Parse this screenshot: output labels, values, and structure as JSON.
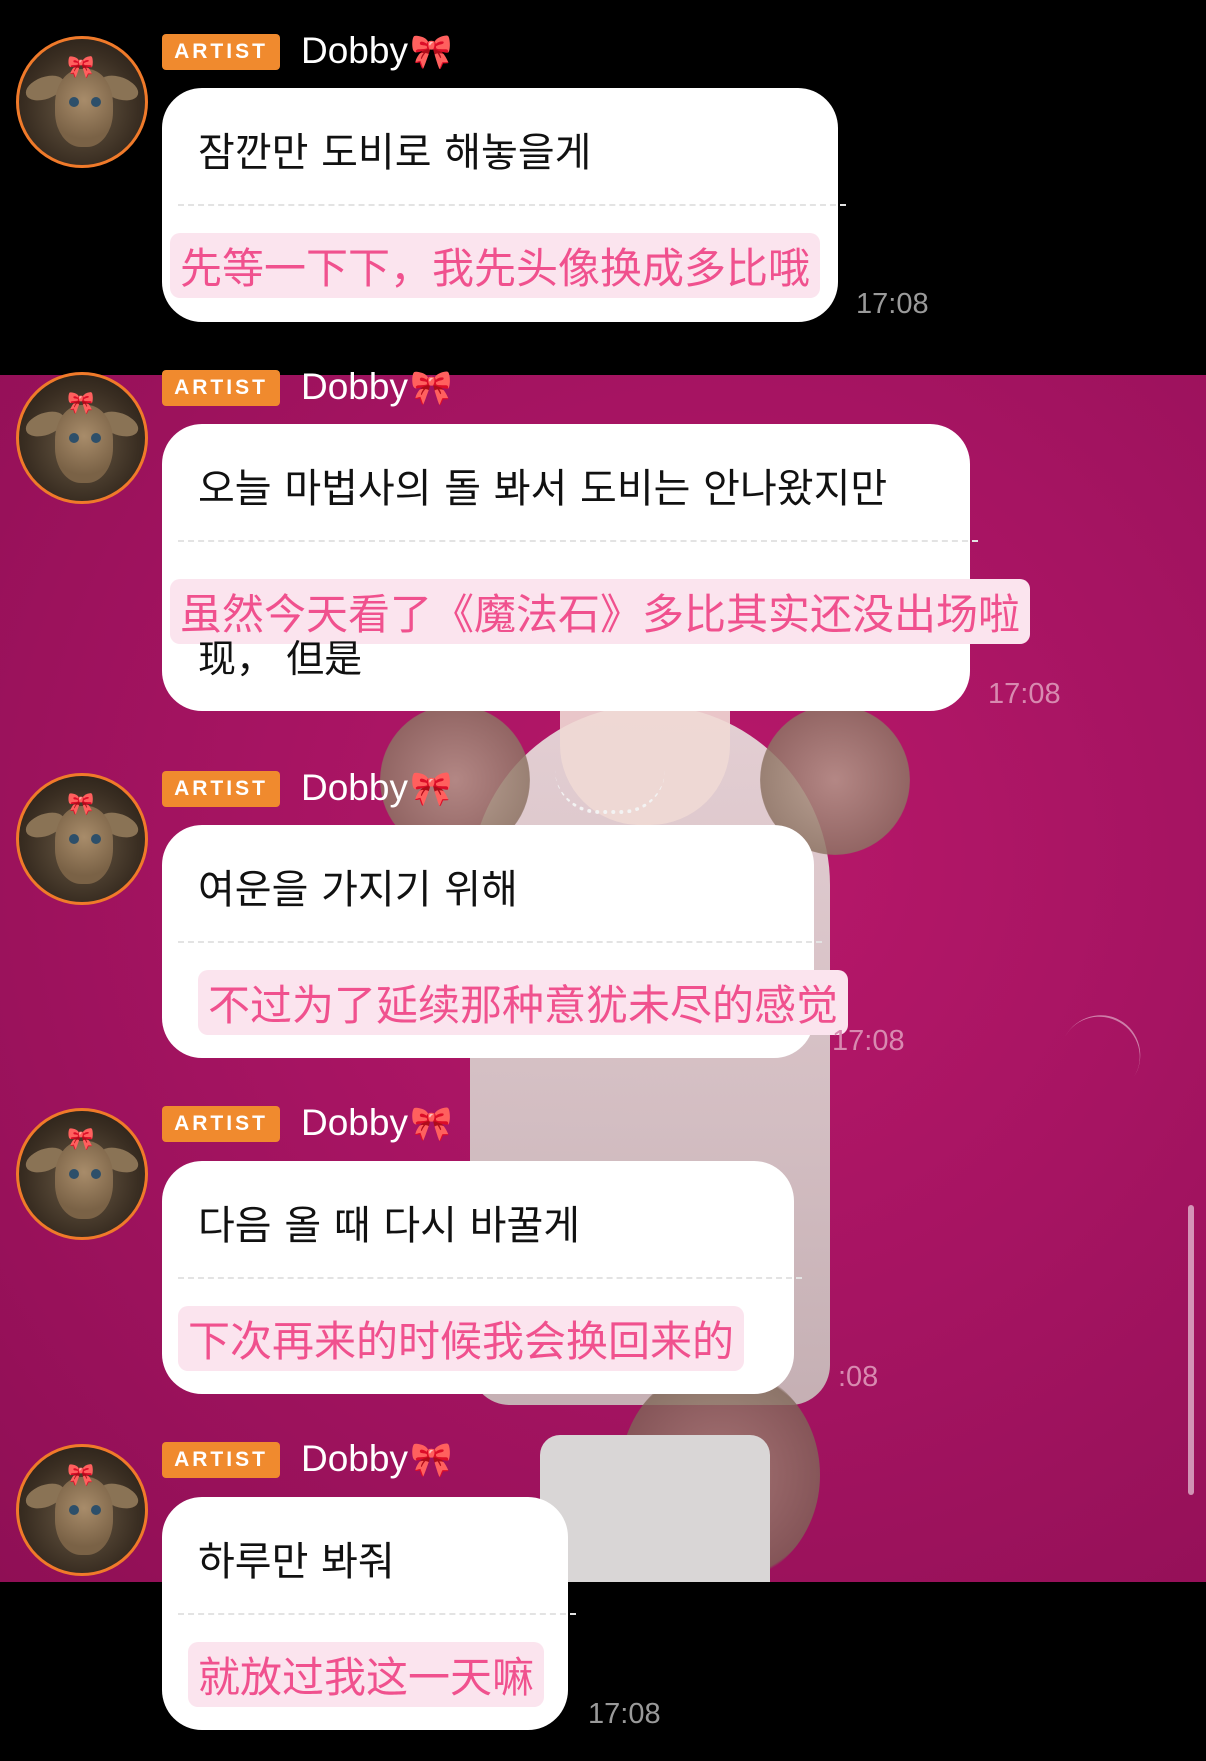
{
  "colors": {
    "accent": "#f08a2e",
    "chinese_text": "#f0518e",
    "background_pink": "#a61462"
  },
  "messages": [
    {
      "badge": "ARTIST",
      "sender": "Dobby",
      "sender_icon": "ribbon-bow-icon",
      "korean": "잠깐만 도비로 해놓을게",
      "chinese": "先等一下下，我先头像换成多比哦",
      "extra": "",
      "time": "17:08"
    },
    {
      "badge": "ARTIST",
      "sender": "Dobby",
      "sender_icon": "ribbon-bow-icon",
      "korean": "오늘 마법사의 돌 봐서 도비는 안나왔지만",
      "chinese": "虽然今天看了《魔法石》多比其实还没出场啦",
      "extra": "现， 但是",
      "time": "17:08"
    },
    {
      "badge": "ARTIST",
      "sender": "Dobby",
      "sender_icon": "ribbon-bow-icon",
      "korean": "여운을 가지기 위해",
      "chinese": "不过为了延续那种意犹未尽的感觉",
      "extra": "",
      "time": "17:08"
    },
    {
      "badge": "ARTIST",
      "sender": "Dobby",
      "sender_icon": "ribbon-bow-icon",
      "korean": "다음 올 때 다시 바꿀게",
      "chinese": "下次再来的时候我会换回来的",
      "extra": "",
      "time": ":08"
    },
    {
      "badge": "ARTIST",
      "sender": "Dobby",
      "sender_icon": "ribbon-bow-icon",
      "korean": "하루만 봐줘",
      "chinese": "就放过我这一天嘛",
      "extra": "",
      "time": "17:08"
    }
  ]
}
